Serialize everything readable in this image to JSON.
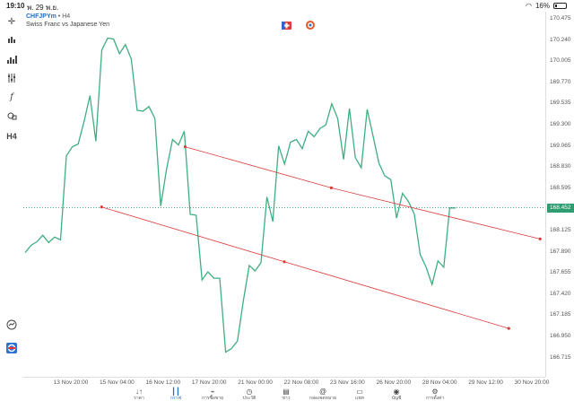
{
  "status": {
    "time": "19:10",
    "date": "พ. 29 พ.ย.",
    "battery": "16%"
  },
  "header": {
    "symbol": "CHFJPYm",
    "timeframe": "H4",
    "description": "Swiss Franc vs Japanese Yen",
    "separator": "•"
  },
  "toolbar_icons": [
    "crosshair-icon",
    "chart-type-icon",
    "indicators-icon",
    "settings-sliders-icon",
    "function-icon",
    "objects-icon",
    "timeframe-icon",
    "chat-icon",
    "logo-icon"
  ],
  "toolbar_timeframe_label": "H4",
  "price_axis": {
    "labels": [
      "170.475",
      "170.240",
      "170.005",
      "169.770",
      "169.535",
      "169.300",
      "169.065",
      "168.830",
      "168.595",
      "168.360",
      "168.125",
      "167.890",
      "167.655",
      "167.420",
      "167.185",
      "166.950",
      "166.715"
    ],
    "current": "168.452"
  },
  "time_axis": {
    "labels": [
      "13 Nov 20:00",
      "15 Nov 04:00",
      "16 Nov 12:00",
      "17 Nov 20:00",
      "21 Nov 00:00",
      "22 Nov 08:00",
      "23 Nov 16:00",
      "26 Nov 20:00",
      "28 Nov 04:00",
      "29 Nov 12:00",
      "30 Nov 20:00"
    ]
  },
  "chart_data": {
    "type": "line",
    "series": [
      {
        "values": [
          167.96,
          168.04,
          168.08,
          168.15,
          168.07,
          168.13,
          168.1,
          169.02,
          169.12,
          169.15,
          169.4,
          169.68,
          169.18,
          170.18,
          170.31,
          170.3,
          170.14,
          170.24,
          170.08,
          169.52,
          169.51,
          169.56,
          169.43,
          168.47,
          168.88,
          169.2,
          169.14,
          169.29,
          168.38,
          168.37,
          167.66,
          167.75,
          167.68,
          167.68,
          166.87,
          166.91,
          166.99,
          167.43,
          167.82,
          167.76,
          167.85,
          168.57,
          168.3,
          169.13,
          168.93,
          169.17,
          169.2,
          169.1,
          169.29,
          169.23,
          169.32,
          169.36,
          169.59,
          169.43,
          168.98,
          169.54,
          169.0,
          168.89,
          169.53,
          169.24,
          168.94,
          168.8,
          168.76,
          168.34,
          168.61,
          168.52,
          168.38,
          167.94,
          167.8,
          167.61,
          167.87,
          167.8,
          168.45,
          168.45
        ]
      }
    ],
    "ylim": [
      166.6,
      170.6
    ],
    "channel": {
      "upper": [
        [
          0.31,
          169.12
        ],
        [
          0.59,
          168.67
        ],
        [
          0.99,
          168.11
        ]
      ],
      "lower": [
        [
          0.15,
          168.46
        ],
        [
          0.5,
          167.86
        ],
        [
          0.93,
          167.13
        ]
      ]
    },
    "current_price": 168.452,
    "colors": {
      "line": "#3fae82",
      "channel": "#d93a3a",
      "current": "#2e9e72"
    }
  },
  "bottom_nav": [
    {
      "icon": "quotes-icon",
      "glyph": "↓↑",
      "label": "ราคา",
      "active": false
    },
    {
      "icon": "chart-icon",
      "glyph": "┃┃",
      "label": "กราฟ",
      "active": true
    },
    {
      "icon": "trade-icon",
      "glyph": "⌁",
      "label": "การซื้อขาย",
      "active": false
    },
    {
      "icon": "history-icon",
      "glyph": "◷",
      "label": "ประวัติ",
      "active": false
    },
    {
      "icon": "news-icon",
      "glyph": "▤",
      "label": "ข่าว",
      "active": false
    },
    {
      "icon": "mailbox-icon",
      "glyph": "@",
      "label": "กล่องจดหมาย",
      "active": false
    },
    {
      "icon": "chat-bubble-icon",
      "glyph": "▭",
      "label": "แชท",
      "active": false
    },
    {
      "icon": "account-icon",
      "glyph": "◉",
      "label": "บัญชี",
      "active": false
    },
    {
      "icon": "settings-icon",
      "glyph": "⚙",
      "label": "การตั้งค่า",
      "active": false
    }
  ]
}
